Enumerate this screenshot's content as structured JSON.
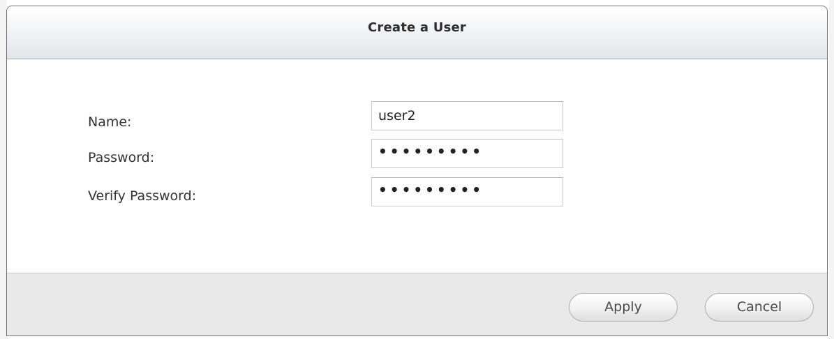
{
  "dialog": {
    "title": "Create a User"
  },
  "form": {
    "name_label": "Name:",
    "name_value": "user2",
    "password_label": "Password:",
    "password_value": "•••••••••",
    "verify_label": "Verify Password:",
    "verify_value": "•••••••••"
  },
  "footer": {
    "apply_label": "Apply",
    "cancel_label": "Cancel"
  }
}
